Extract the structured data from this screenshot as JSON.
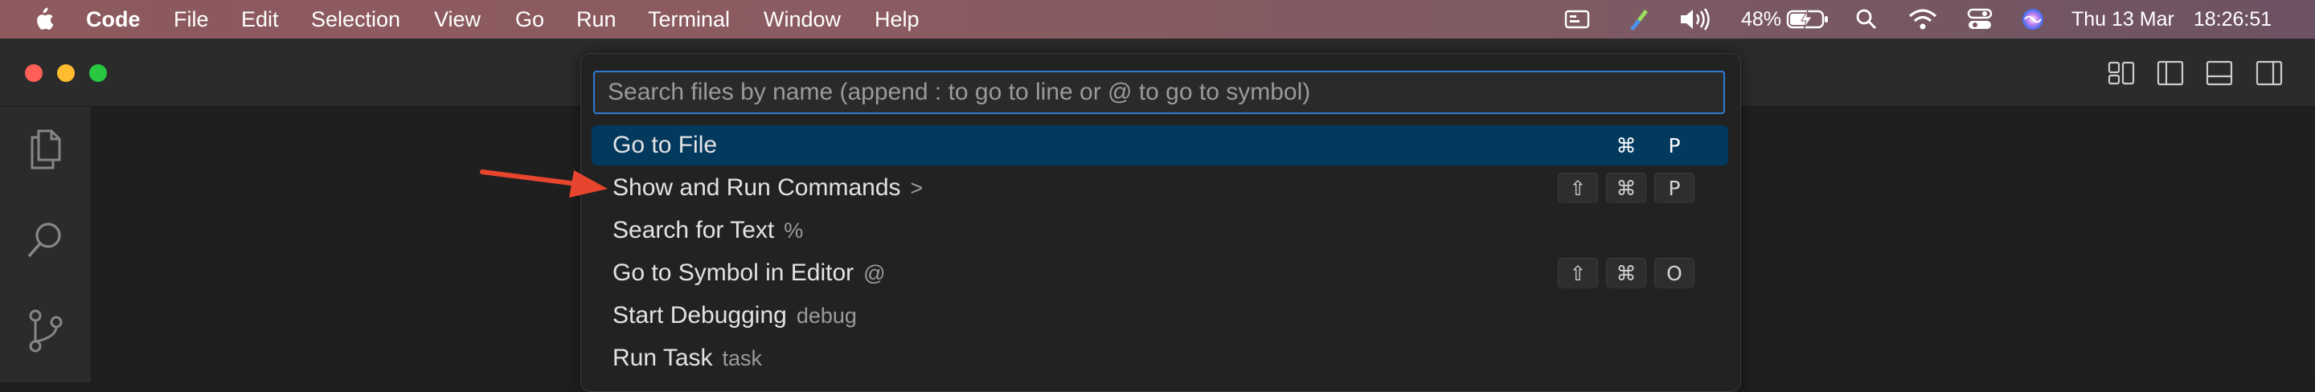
{
  "menubar": {
    "app": "Code",
    "items": [
      "File",
      "Edit",
      "Selection",
      "View",
      "Go",
      "Run",
      "Terminal",
      "Window",
      "Help"
    ],
    "battery": "48%",
    "date": "Thu 13 Mar",
    "time": "18:26:51"
  },
  "quick_open": {
    "placeholder": "Search files by name (append : to go to line or @ to go to symbol)",
    "items": [
      {
        "label": "Go to File",
        "prefix": "",
        "keys": [
          "⌘",
          "P"
        ],
        "selected": true
      },
      {
        "label": "Show and Run Commands",
        "prefix": ">",
        "keys": [
          "⇧",
          "⌘",
          "P"
        ]
      },
      {
        "label": "Search for Text",
        "prefix": "%",
        "keys": []
      },
      {
        "label": "Go to Symbol in Editor",
        "prefix": "@",
        "keys": [
          "⇧",
          "⌘",
          "O"
        ]
      },
      {
        "label": "Start Debugging",
        "prefix": "debug",
        "keys": []
      },
      {
        "label": "Run Task",
        "prefix": "task",
        "keys": []
      }
    ]
  },
  "activity_bar": {
    "icons": [
      "explorer-icon",
      "search-icon",
      "source-control-icon"
    ]
  },
  "colors": {
    "selected_row": "#04395e",
    "input_focus_border": "#2f7ad1",
    "annotation_arrow": "#e8452f"
  }
}
